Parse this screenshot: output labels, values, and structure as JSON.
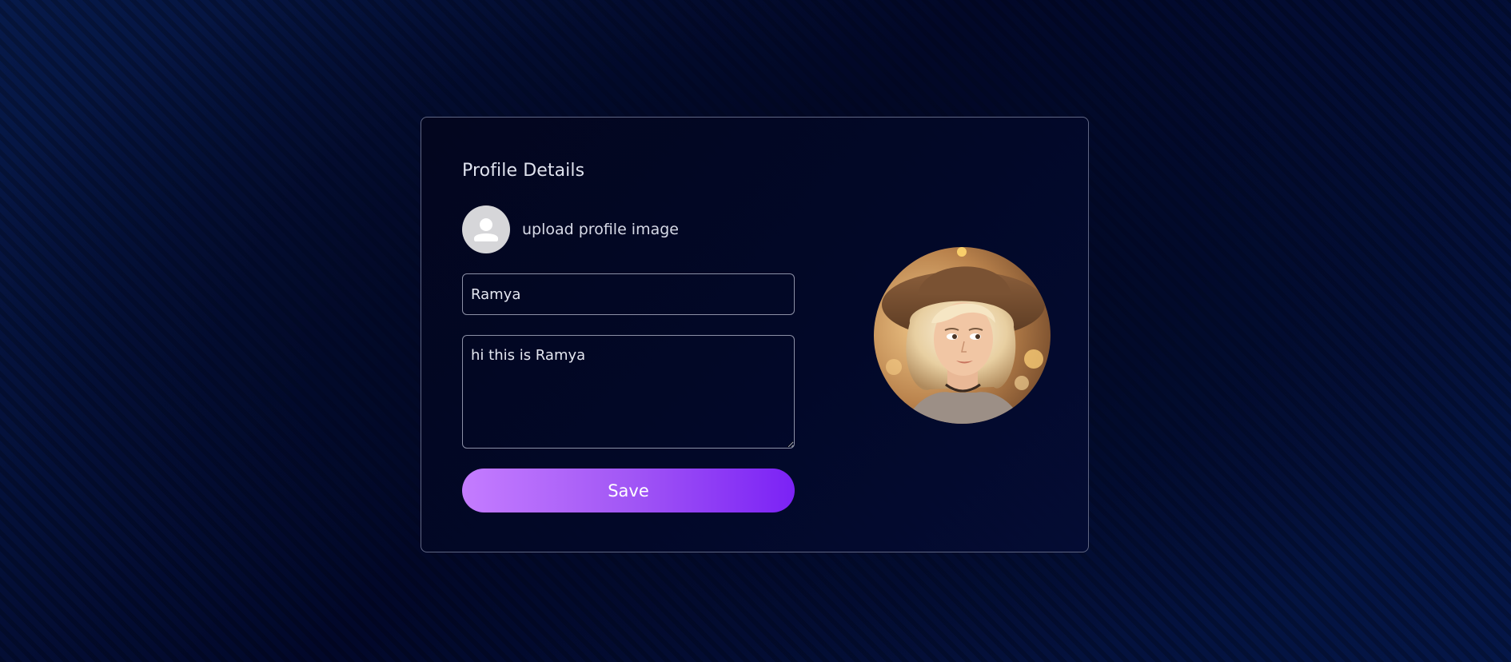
{
  "profile": {
    "title": "Profile Details",
    "upload_label": "upload profile image",
    "name_value": "Ramya",
    "bio_value": "hi this is Ramya",
    "save_label": "Save",
    "photo_alt": "profile picture",
    "accent_gradient": [
      "#c47cff",
      "#7b22f5"
    ],
    "placeholder_avatar_icon": "user-silhouette-icon"
  }
}
